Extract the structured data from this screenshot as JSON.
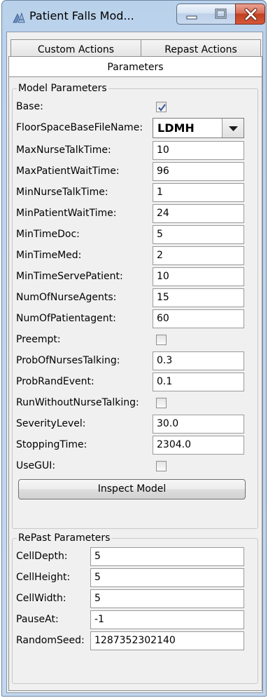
{
  "window": {
    "title": "Patient Falls Mod..."
  },
  "tabs": {
    "custom_actions": "Custom Actions",
    "repast_actions": "Repast Actions",
    "parameters": "Parameters"
  },
  "model_parameters": {
    "legend": "Model Parameters",
    "rows": [
      {
        "label": "Base:",
        "type": "checkbox",
        "checked": true
      },
      {
        "label": "FloorSpaceBaseFileName:",
        "type": "combo",
        "value": "LDMH"
      },
      {
        "label": "MaxNurseTalkTime:",
        "type": "text",
        "value": "10"
      },
      {
        "label": "MaxPatientWaitTime:",
        "type": "text",
        "value": "96"
      },
      {
        "label": "MinNurseTalkTime:",
        "type": "text",
        "value": "1"
      },
      {
        "label": "MinPatientWaitTime:",
        "type": "text",
        "value": "24"
      },
      {
        "label": "MinTimeDoc:",
        "type": "text",
        "value": "5"
      },
      {
        "label": "MinTimeMed:",
        "type": "text",
        "value": "2"
      },
      {
        "label": "MinTimeServePatient:",
        "type": "text",
        "value": "10"
      },
      {
        "label": "NumOfNurseAgents:",
        "type": "text",
        "value": "15"
      },
      {
        "label": "NumOfPatientagent:",
        "type": "text",
        "value": "60"
      },
      {
        "label": "Preempt:",
        "type": "checkbox",
        "checked": false
      },
      {
        "label": "ProbOfNursesTalking:",
        "type": "text",
        "value": "0.3"
      },
      {
        "label": "ProbRandEvent:",
        "type": "text",
        "value": "0.1"
      },
      {
        "label": "RunWithoutNurseTalking:",
        "type": "checkbox",
        "checked": false
      },
      {
        "label": "SeverityLevel:",
        "type": "text",
        "value": "30.0"
      },
      {
        "label": "StoppingTime:",
        "type": "text",
        "value": "2304.0"
      },
      {
        "label": "UseGUI:",
        "type": "checkbox",
        "checked": false
      }
    ],
    "inspect_button": "Inspect Model"
  },
  "repast_parameters": {
    "legend": "RePast Parameters",
    "rows": [
      {
        "label": "CellDepth:",
        "value": "5"
      },
      {
        "label": "CellHeight:",
        "value": "5"
      },
      {
        "label": "CellWidth:",
        "value": "5"
      },
      {
        "label": "PauseAt:",
        "value": "-1"
      },
      {
        "label": "RandomSeed:",
        "value": "1287352302140"
      }
    ]
  },
  "icons": {
    "app": "repast-app-icon",
    "minimize": "minimize-icon",
    "maximize": "maximize-icon",
    "close": "close-icon",
    "checkmark": "checkmark-icon",
    "dropdown": "chevron-down-icon"
  },
  "colors": {
    "frame": "#b9d1ea",
    "close_button": "#c2401f",
    "checkmark": "#3c5a9a",
    "panel": "#f0f0f0"
  }
}
